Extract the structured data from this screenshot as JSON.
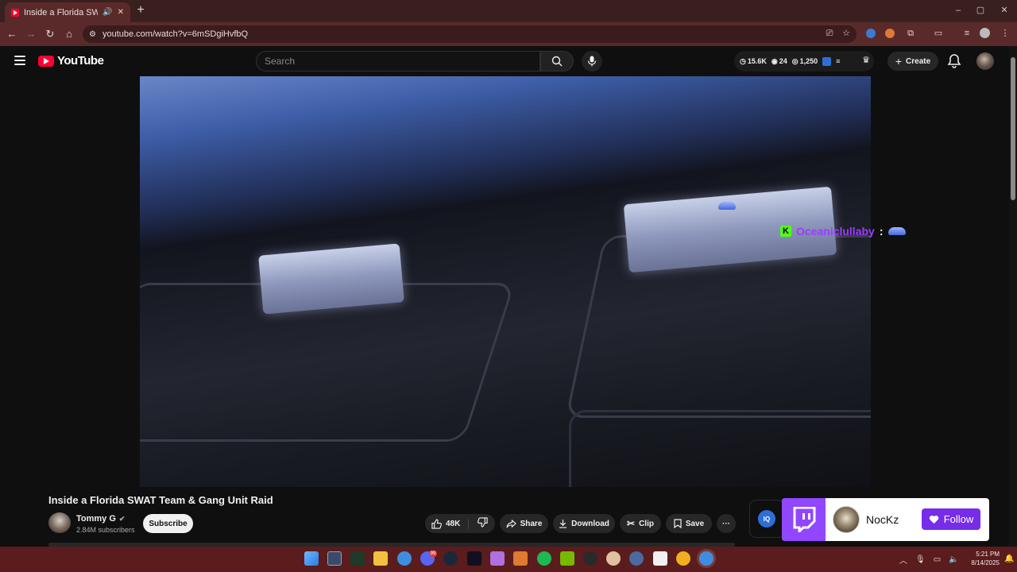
{
  "browser": {
    "tab_title": "Inside a Florida SWAT Team",
    "new_tab": "+",
    "url": "youtube.com/watch?v=6mSDgiHvfbQ",
    "window_controls": [
      "–",
      "▢",
      "✕"
    ]
  },
  "youtube": {
    "logo_text": "YouTube",
    "search_placeholder": "Search",
    "stats": {
      "watch_time": "15.6K",
      "comments": "24",
      "views": "1,250"
    },
    "create_label": "Create"
  },
  "overlay": {
    "chat_user": "Oceaniclullaby",
    "chat_sep": ":",
    "badge": "K"
  },
  "video_info": {
    "title": "Inside a Florida SWAT Team & Gang Unit Raid",
    "channel": "Tommy G",
    "subscribers": "2.84M subscribers",
    "subscribe_label": "Subscribe",
    "likes": "48K",
    "share_label": "Share",
    "download_label": "Download",
    "clip_label": "Clip",
    "save_label": "Save",
    "more_label": "···"
  },
  "twitch_card": {
    "iq_label": "IQ",
    "streamer": "NocKz",
    "follow_label": "Follow"
  },
  "taskbar": {
    "discord_badge": "99",
    "time": "5:21 PM",
    "date": "8/14/2025"
  },
  "colors": {
    "accent_red": "#ff0033",
    "twitch_purple": "#9146ff",
    "follow_purple": "#772ce8",
    "kick_green": "#53fc18",
    "chat_name": "#9b3dff"
  }
}
